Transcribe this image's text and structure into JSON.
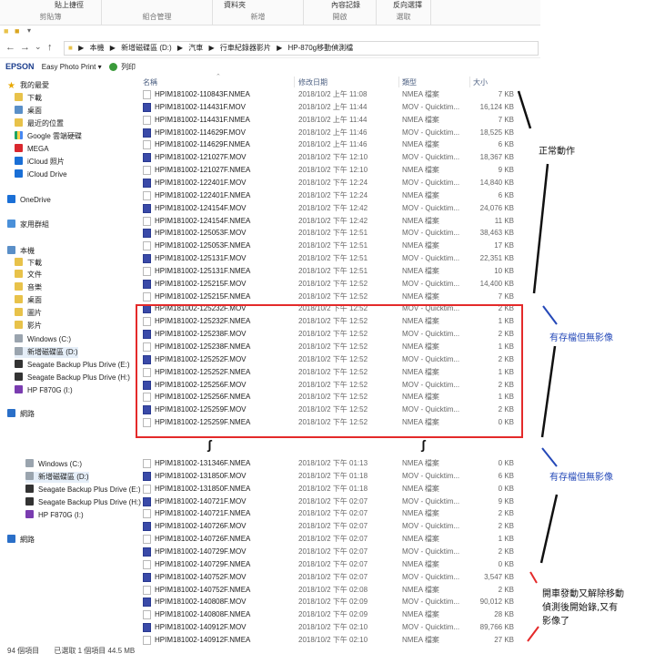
{
  "ribbon": {
    "groups": [
      {
        "top": "貼上捷徑",
        "label": "剪貼簿"
      },
      {
        "top": "",
        "label": "組合管理"
      },
      {
        "top": "資料夾",
        "label": "新增"
      },
      {
        "top": "內容記錄",
        "label": "開啟"
      },
      {
        "top": "反向選擇",
        "label": "選取"
      }
    ]
  },
  "address": {
    "back": "←",
    "forward": "→",
    "down": "⌄",
    "up": "↑",
    "crumbs": [
      "▶",
      "本機",
      "▶",
      "新增磁碟區 (D:)",
      "▶",
      "汽車",
      "▶",
      "行車紀錄器影片",
      "▶",
      "HP-870g移動偵測檔"
    ]
  },
  "epson": {
    "logo": "EPSON",
    "app": "Easy Photo Print",
    "arrow": "▾",
    "print": "列印"
  },
  "columns": {
    "name": "名稱",
    "date": "修改日期",
    "type": "類型",
    "size": "大小"
  },
  "sidebar": [
    {
      "label": "我的最愛",
      "icon": "star",
      "name": "favorites"
    },
    {
      "label": "下載",
      "icon": "folder",
      "name": "downloads"
    },
    {
      "label": "桌面",
      "icon": "pc",
      "name": "desktop"
    },
    {
      "label": "最近的位置",
      "icon": "folder",
      "name": "recent"
    },
    {
      "label": "Google 雲端硬碟",
      "icon": "gdrive",
      "name": "google-drive"
    },
    {
      "label": "MEGA",
      "icon": "mega",
      "name": "mega"
    },
    {
      "label": "iCloud 照片",
      "icon": "cloud",
      "name": "icloud-photos"
    },
    {
      "label": "iCloud Drive",
      "icon": "cloud",
      "name": "icloud-drive"
    },
    {
      "label": "OneDrive",
      "icon": "cloud",
      "name": "onedrive"
    },
    {
      "label": "家用群組",
      "icon": "home",
      "name": "homegroup"
    },
    {
      "label": "本機",
      "icon": "pc",
      "name": "this-pc"
    },
    {
      "label": "下載",
      "icon": "folder",
      "name": "pc-downloads"
    },
    {
      "label": "文件",
      "icon": "folder",
      "name": "documents"
    },
    {
      "label": "音樂",
      "icon": "folder",
      "name": "music"
    },
    {
      "label": "桌面",
      "icon": "folder",
      "name": "pc-desktop"
    },
    {
      "label": "圖片",
      "icon": "folder",
      "name": "pictures"
    },
    {
      "label": "影片",
      "icon": "folder",
      "name": "videos"
    },
    {
      "label": "Windows (C:)",
      "icon": "drive",
      "name": "drive-c"
    },
    {
      "label": "新增磁碟區 (D:)",
      "icon": "drive",
      "name": "drive-d",
      "selected": true
    },
    {
      "label": "Seagate Backup Plus Drive (E:)",
      "icon": "hdd",
      "name": "drive-e"
    },
    {
      "label": "Seagate Backup Plus Drive (H:)",
      "icon": "hdd",
      "name": "drive-h"
    },
    {
      "label": "HP F870G (I:)",
      "icon": "hp",
      "name": "drive-i"
    },
    {
      "label": "網路",
      "icon": "net",
      "name": "network"
    },
    {
      "label": "Windows (C:)",
      "icon": "drive",
      "name": "drive-c-2"
    },
    {
      "label": "新增磁碟區 (D:)",
      "icon": "drive",
      "name": "drive-d-2",
      "selected": true
    },
    {
      "label": "Seagate Backup Plus Drive (E:)",
      "icon": "hdd",
      "name": "drive-e-2"
    },
    {
      "label": "Seagate Backup Plus Drive (H:)",
      "icon": "hdd",
      "name": "drive-h-2"
    },
    {
      "label": "HP F870G (I:)",
      "icon": "hp",
      "name": "drive-i-2"
    },
    {
      "label": "網路",
      "icon": "net",
      "name": "network-2"
    }
  ],
  "files": [
    {
      "name": "HPIM181002-110843F.NMEA",
      "date": "2018/10/2 上午 11:08",
      "type": "NMEA 檔案",
      "size": "7 KB"
    },
    {
      "name": "HPIM181002-114431F.MOV",
      "date": "2018/10/2 上午 11:44",
      "type": "MOV - Quicktim...",
      "size": "16,124 KB"
    },
    {
      "name": "HPIM181002-114431F.NMEA",
      "date": "2018/10/2 上午 11:44",
      "type": "NMEA 檔案",
      "size": "7 KB"
    },
    {
      "name": "HPIM181002-114629F.MOV",
      "date": "2018/10/2 上午 11:46",
      "type": "MOV - Quicktim...",
      "size": "18,525 KB"
    },
    {
      "name": "HPIM181002-114629F.NMEA",
      "date": "2018/10/2 上午 11:46",
      "type": "NMEA 檔案",
      "size": "6 KB"
    },
    {
      "name": "HPIM181002-121027F.MOV",
      "date": "2018/10/2 下午 12:10",
      "type": "MOV - Quicktim...",
      "size": "18,367 KB"
    },
    {
      "name": "HPIM181002-121027F.NMEA",
      "date": "2018/10/2 下午 12:10",
      "type": "NMEA 檔案",
      "size": "9 KB"
    },
    {
      "name": "HPIM181002-122401F.MOV",
      "date": "2018/10/2 下午 12:24",
      "type": "MOV - Quicktim...",
      "size": "14,840 KB"
    },
    {
      "name": "HPIM181002-122401F.NMEA",
      "date": "2018/10/2 下午 12:24",
      "type": "NMEA 檔案",
      "size": "6 KB"
    },
    {
      "name": "HPIM181002-124154F.MOV",
      "date": "2018/10/2 下午 12:42",
      "type": "MOV - Quicktim...",
      "size": "24,076 KB"
    },
    {
      "name": "HPIM181002-124154F.NMEA",
      "date": "2018/10/2 下午 12:42",
      "type": "NMEA 檔案",
      "size": "11 KB"
    },
    {
      "name": "HPIM181002-125053F.MOV",
      "date": "2018/10/2 下午 12:51",
      "type": "MOV - Quicktim...",
      "size": "38,463 KB"
    },
    {
      "name": "HPIM181002-125053F.NMEA",
      "date": "2018/10/2 下午 12:51",
      "type": "NMEA 檔案",
      "size": "17 KB"
    },
    {
      "name": "HPIM181002-125131F.MOV",
      "date": "2018/10/2 下午 12:51",
      "type": "MOV - Quicktim...",
      "size": "22,351 KB"
    },
    {
      "name": "HPIM181002-125131F.NMEA",
      "date": "2018/10/2 下午 12:51",
      "type": "NMEA 檔案",
      "size": "10 KB"
    },
    {
      "name": "HPIM181002-125215F.MOV",
      "date": "2018/10/2 下午 12:52",
      "type": "MOV - Quicktim...",
      "size": "14,400 KB"
    },
    {
      "name": "HPIM181002-125215F.NMEA",
      "date": "2018/10/2 下午 12:52",
      "type": "NMEA 檔案",
      "size": "7 KB"
    },
    {
      "name": "HPIM181002-125232F.MOV",
      "date": "2018/10/2 下午 12:52",
      "type": "MOV - Quicktim...",
      "size": "2 KB"
    },
    {
      "name": "HPIM181002-125232F.NMEA",
      "date": "2018/10/2 下午 12:52",
      "type": "NMEA 檔案",
      "size": "1 KB"
    },
    {
      "name": "HPIM181002-125238F.MOV",
      "date": "2018/10/2 下午 12:52",
      "type": "MOV - Quicktim...",
      "size": "2 KB"
    },
    {
      "name": "HPIM181002-125238F.NMEA",
      "date": "2018/10/2 下午 12:52",
      "type": "NMEA 檔案",
      "size": "1 KB"
    },
    {
      "name": "HPIM181002-125252F.MOV",
      "date": "2018/10/2 下午 12:52",
      "type": "MOV - Quicktim...",
      "size": "2 KB"
    },
    {
      "name": "HPIM181002-125252F.NMEA",
      "date": "2018/10/2 下午 12:52",
      "type": "NMEA 檔案",
      "size": "1 KB"
    },
    {
      "name": "HPIM181002-125256F.MOV",
      "date": "2018/10/2 下午 12:52",
      "type": "MOV - Quicktim...",
      "size": "2 KB"
    },
    {
      "name": "HPIM181002-125256F.NMEA",
      "date": "2018/10/2 下午 12:52",
      "type": "NMEA 檔案",
      "size": "1 KB"
    },
    {
      "name": "HPIM181002-125259F.MOV",
      "date": "2018/10/2 下午 12:52",
      "type": "MOV - Quicktim...",
      "size": "2 KB"
    },
    {
      "name": "HPIM181002-125259F.NMEA",
      "date": "2018/10/2 下午 12:52",
      "type": "NMEA 檔案",
      "size": "0 KB"
    },
    {
      "name": "HPIM181002-131346F.NMEA",
      "date": "2018/10/2 下午 01:13",
      "type": "NMEA 檔案",
      "size": "0 KB"
    },
    {
      "name": "HPIM181002-131850F.MOV",
      "date": "2018/10/2 下午 01:18",
      "type": "MOV - Quicktim...",
      "size": "6 KB"
    },
    {
      "name": "HPIM181002-131850F.NMEA",
      "date": "2018/10/2 下午 01:18",
      "type": "NMEA 檔案",
      "size": "0 KB"
    },
    {
      "name": "HPIM181002-140721F.MOV",
      "date": "2018/10/2 下午 02:07",
      "type": "MOV - Quicktim...",
      "size": "9 KB"
    },
    {
      "name": "HPIM181002-140721F.NMEA",
      "date": "2018/10/2 下午 02:07",
      "type": "NMEA 檔案",
      "size": "2 KB"
    },
    {
      "name": "HPIM181002-140726F.MOV",
      "date": "2018/10/2 下午 02:07",
      "type": "MOV - Quicktim...",
      "size": "2 KB"
    },
    {
      "name": "HPIM181002-140726F.NMEA",
      "date": "2018/10/2 下午 02:07",
      "type": "NMEA 檔案",
      "size": "1 KB"
    },
    {
      "name": "HPIM181002-140729F.MOV",
      "date": "2018/10/2 下午 02:07",
      "type": "MOV - Quicktim...",
      "size": "2 KB"
    },
    {
      "name": "HPIM181002-140729F.NMEA",
      "date": "2018/10/2 下午 02:07",
      "type": "NMEA 檔案",
      "size": "0 KB"
    },
    {
      "name": "HPIM181002-140752F.MOV",
      "date": "2018/10/2 下午 02:07",
      "type": "MOV - Quicktim...",
      "size": "3,547 KB"
    },
    {
      "name": "HPIM181002-140752F.NMEA",
      "date": "2018/10/2 下午 02:08",
      "type": "NMEA 檔案",
      "size": "2 KB"
    },
    {
      "name": "HPIM181002-140808F.MOV",
      "date": "2018/10/2 下午 02:09",
      "type": "MOV - Quicktim...",
      "size": "90,012 KB"
    },
    {
      "name": "HPIM181002-140808F.NMEA",
      "date": "2018/10/2 下午 02:09",
      "type": "NMEA 檔案",
      "size": "28 KB"
    },
    {
      "name": "HPIM181002-140912F.MOV",
      "date": "2018/10/2 下午 02:10",
      "type": "MOV - Quicktim...",
      "size": "89,766 KB"
    },
    {
      "name": "HPIM181002-140912F.NMEA",
      "date": "2018/10/2 下午 02:10",
      "type": "NMEA 檔案",
      "size": "27 KB"
    }
  ],
  "status": {
    "count": "94 個項目",
    "selected": "已選取 1 個項目 44.5 MB"
  },
  "annotations": {
    "normal": "正常動作",
    "no_video_1": "有存檔但無影像",
    "no_video_2": "有存檔但無影像",
    "restart_1": "開車發動又解除移動",
    "restart_2": "偵測後開始錄,又有",
    "restart_3": "影像了"
  },
  "colors": {
    "highlight_box": "#e42a2a",
    "annotation_blue": "#2448b8",
    "annotation_red": "#e42a2a"
  }
}
